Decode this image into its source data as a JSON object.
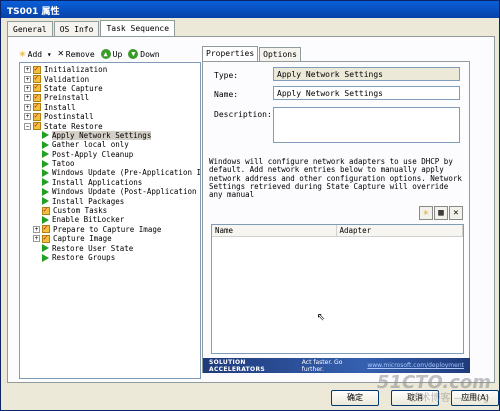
{
  "window": {
    "title": "TS001 属性"
  },
  "tabs": [
    {
      "label": "General"
    },
    {
      "label": "OS Info"
    },
    {
      "label": "Task Sequence"
    }
  ],
  "toolbar": {
    "add": "Add ▾",
    "remove": "Remove",
    "up": "Up",
    "down": "Down"
  },
  "tree": [
    {
      "label": "Initialization",
      "kind": "folder",
      "expander": "+"
    },
    {
      "label": "Validation",
      "kind": "folder",
      "expander": "+"
    },
    {
      "label": "State Capture",
      "kind": "folder",
      "expander": "+"
    },
    {
      "label": "Preinstall",
      "kind": "folder",
      "expander": "+"
    },
    {
      "label": "Install",
      "kind": "folder",
      "expander": "+"
    },
    {
      "label": "Postinstall",
      "kind": "folder",
      "expander": "+"
    },
    {
      "label": "State Restore",
      "kind": "folder",
      "expander": "−"
    },
    {
      "label": "Apply Network Settings",
      "kind": "step",
      "selected": true
    },
    {
      "label": "Gather local only",
      "kind": "step"
    },
    {
      "label": "Post-Apply Cleanup",
      "kind": "step"
    },
    {
      "label": "Tatoo",
      "kind": "step"
    },
    {
      "label": "Windows Update (Pre-Application I",
      "kind": "step"
    },
    {
      "label": "Install Applications",
      "kind": "step"
    },
    {
      "label": "Windows Update (Post-Application",
      "kind": "step"
    },
    {
      "label": "Install Packages",
      "kind": "step"
    },
    {
      "label": "Custom Tasks",
      "kind": "folder"
    },
    {
      "label": "Enable BitLocker",
      "kind": "step"
    },
    {
      "label": "Prepare to Capture Image",
      "kind": "folder",
      "expander": "+"
    },
    {
      "label": "Capture Image",
      "kind": "folder",
      "expander": "+"
    },
    {
      "label": "Restore User State",
      "kind": "step"
    },
    {
      "label": "Restore Groups",
      "kind": "step"
    }
  ],
  "right_tabs": [
    {
      "label": "Properties"
    },
    {
      "label": "Options"
    }
  ],
  "properties": {
    "type_label": "Type:",
    "type_value": "Apply Network Settings",
    "name_label": "Name:",
    "name_value": "Apply Network Settings",
    "description_label": "Description:",
    "description_value": "",
    "info_text": "Windows will configure network adapters to use DHCP by default. Add network entries below to manually apply network address and other configuration options. Network Settings retrieved during State Capture will override any manual"
  },
  "list": {
    "columns": [
      "Name",
      "Adapter"
    ],
    "buttons": {
      "add": "✳",
      "edit": "▦",
      "delete": "✕"
    }
  },
  "banner": {
    "brand": "SOLUTION ACCELERATORS",
    "tagline": "Act faster. Go further.",
    "link": "www.microsoft.com/deployment"
  },
  "buttons": {
    "ok": "确定",
    "cancel": "取消",
    "apply": "应用(A)"
  },
  "watermark": {
    "line1": "51CTO.com",
    "line2": "技术博客 — Blog"
  }
}
